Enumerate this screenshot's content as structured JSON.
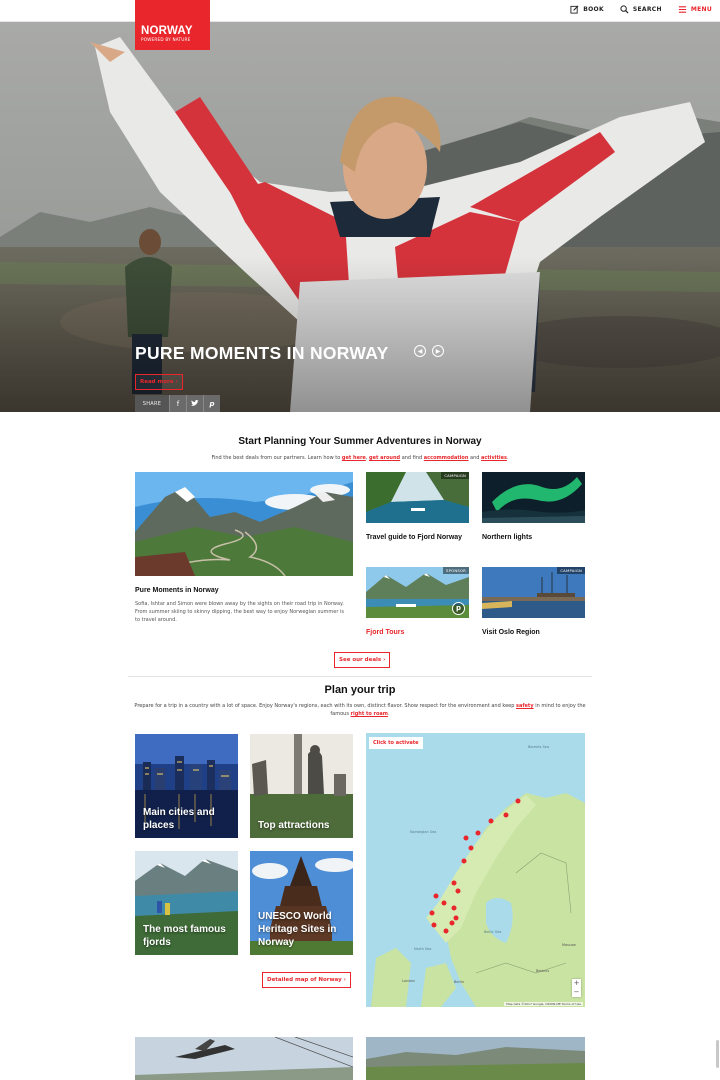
{
  "brand": {
    "name": "NORWAY",
    "tagline": "POWERED BY NATURE"
  },
  "nav": {
    "book": "BOOK",
    "search": "SEARCH",
    "menu": "MENU"
  },
  "hero": {
    "title": "PURE MOMENTS IN NORWAY",
    "read_more": "Read more ›",
    "share_label": "SHARE"
  },
  "plan_summer": {
    "title": "Start Planning Your Summer Adventures in Norway",
    "intro_prefix": "Find the best deals from our partners. Learn how to",
    "link_get_here": "get here",
    "link_get_around": "get around",
    "intro_mid": "and find",
    "link_accommodation": "accommodation",
    "intro_and": "and",
    "link_activities": "activities",
    "feature": {
      "title": "Pure Moments in Norway",
      "description": "Sofia, Ishtar and Simon were blown away by the sights on their road trip in Norway. From summer skiing to skinny dipping, the best way to enjoy Norwegian summer is to travel around."
    },
    "cards": [
      {
        "title": "Travel guide to Fjord Norway",
        "tag": "CAMPAIGN"
      },
      {
        "title": "Northern lights",
        "tag": ""
      },
      {
        "title": "Fjord Tours",
        "tag": "SPONSOR"
      },
      {
        "title": "Visit Oslo Region",
        "tag": "CAMPAIGN"
      }
    ],
    "deals_button": "See our deals ›"
  },
  "plan_trip": {
    "title": "Plan your trip",
    "intro": "Prepare for a trip in a country with a lot of space.  Enjoy Norway's regions, each with its own, distinct flavor. Show respect for the environment and keep",
    "link_safety": "safety",
    "intro_mid": "in mind to enjoy the famous",
    "link_right_to_roam": "right to roam",
    "tiles": [
      {
        "title": "Main cities and places"
      },
      {
        "title": "Top attractions"
      },
      {
        "title": "The most famous fjords"
      },
      {
        "title": "UNESCO World Heritage Sites in Norway"
      }
    ],
    "map_button": "Detailed map of Norway ›",
    "map": {
      "activate": "Click to activate",
      "labels": {
        "barents": "Barents Sea",
        "norwegian": "Norwegian Sea",
        "north": "North Sea",
        "baltic": "Baltic Sea",
        "belarus": "Belarus",
        "london": "London",
        "berlin": "Berlin",
        "moscow": "Moscow"
      },
      "zoom_in": "+",
      "zoom_out": "−",
      "footer": "Map data ©2017 Google, ORION-ME   Terms of Use"
    }
  },
  "colors": {
    "accent": "#e8262b",
    "map_water": "#a9dbea",
    "map_land": "#c9e3a3"
  }
}
